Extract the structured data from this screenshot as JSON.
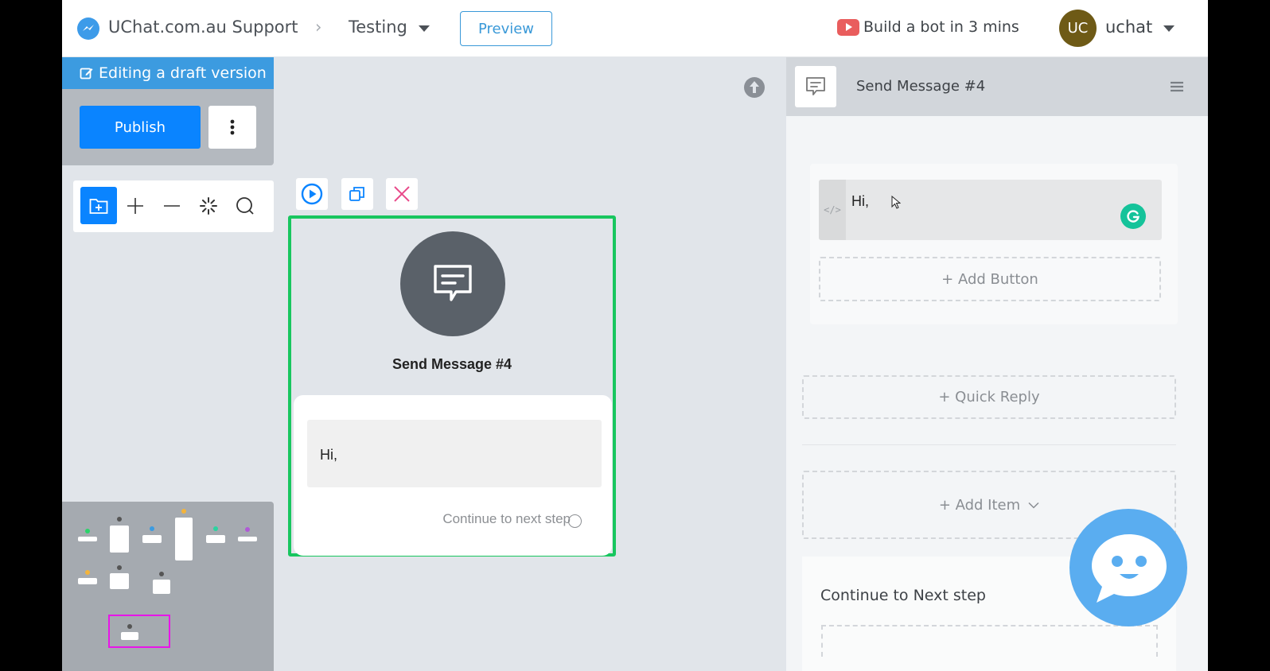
{
  "topbar": {
    "page_name": "UChat.com.au Support",
    "breadcrumb_sep": "›",
    "flow_name": "Testing",
    "preview_label": "Preview",
    "promo_label": "Build a bot in 3 mins",
    "avatar_initials": "UC",
    "username": "uchat",
    "colors": {
      "avatar": "#6e5a16",
      "preview": "#3a99d8",
      "promo_icon": "#e95d5d"
    }
  },
  "left_panel": {
    "draft_banner": "Editing a draft version",
    "publish_label": "Publish",
    "more_icon": "vertical-ellipsis-icon",
    "tools": [
      {
        "name": "add-folder-tool",
        "icon": "folder-plus-icon",
        "active": true
      },
      {
        "name": "zoom-in-tool",
        "icon": "plus-icon",
        "active": false
      },
      {
        "name": "zoom-out-tool",
        "icon": "minus-icon",
        "active": false
      },
      {
        "name": "loading-tool",
        "icon": "spinner-icon",
        "active": false
      },
      {
        "name": "search-tool",
        "icon": "search-icon",
        "active": false
      }
    ],
    "colors": {
      "banner": "#3c9be0",
      "publish": "#0a84ff"
    }
  },
  "canvas": {
    "node_tools": [
      "play-icon",
      "duplicate-icon",
      "close-icon"
    ],
    "node": {
      "title": "Send Message #4",
      "message": "Hi,",
      "continue_label": "Continue to next step",
      "border_color": "#18c65f"
    }
  },
  "right_panel": {
    "title": "Send Message #4",
    "message_text": "Hi,",
    "add_button_label": "+ Add Button",
    "quick_reply_label": "+ Quick Reply",
    "add_item_label": "+ Add Item",
    "continue_label": "Continue to Next step"
  }
}
